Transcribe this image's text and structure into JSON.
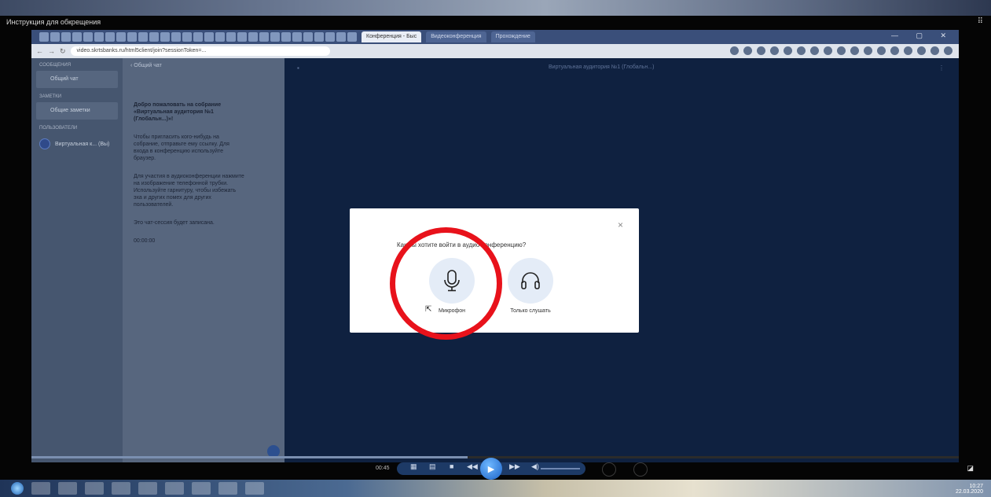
{
  "player": {
    "title": "Инструкция для обкрещения",
    "corner_label": "⠿",
    "time": "00:45",
    "seek_progress": 0.47
  },
  "browser": {
    "tabs": [
      "Конференция - Быс",
      "Видеоконференция",
      "Прохождение"
    ],
    "url": "video.skrtsbanks.ru/html5client/join?sessionToken=...",
    "window_controls": "—  ▢  ✕"
  },
  "left_panel": {
    "section_messages": "СООБЩЕНИЯ",
    "public_chat": "Общий чат",
    "section_notes": "ЗАМЕТКИ",
    "shared_notes": "Общие заметки",
    "section_users": "ПОЛЬЗОВАТЕЛИ",
    "user_name": "Виртуальная к... (Вы)"
  },
  "chat": {
    "header": "‹ Общий чат",
    "welcome": "Добро пожаловать на собрание «Виртуальная аудитория №1 (Глобальн...)»!",
    "msg1": "Чтобы пригласить кого-нибудь на собрание, отправьте ему ссылку. Для входа в конференцию используйте браузер.",
    "msg2": "Для участия в аудиоконференции нажмите на изображение телефонной трубки. Используйте гарнитуру, чтобы избежать эха и других помех для других пользователей.",
    "msg3": "Это чат-сессия будет записана.",
    "msg4": "00:00:00"
  },
  "presentation": {
    "title": "Виртуальная аудитория №1 (Глобальн...)"
  },
  "modal": {
    "question": "Как вы хотите войти в аудио-конференцию?",
    "close": "×",
    "mic_label": "Микрофон",
    "listen_label": "Только слушать"
  },
  "tray": {
    "time": "10:27",
    "date": "22.03.2020"
  }
}
